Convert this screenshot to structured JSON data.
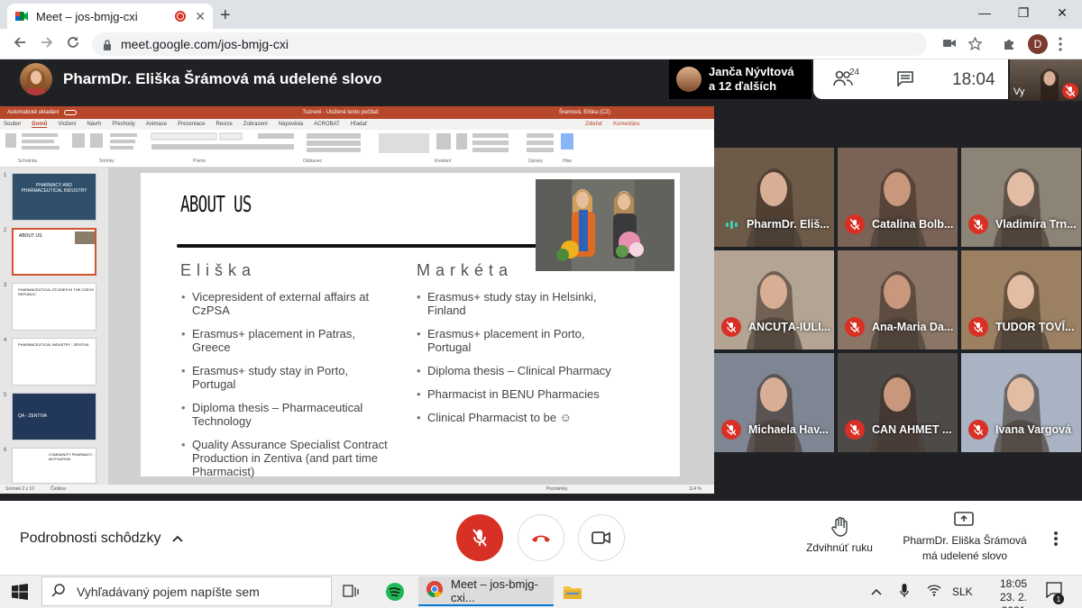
{
  "browser": {
    "tab_title": "Meet – jos-bmjg-cxi",
    "close_glyph": "✕",
    "new_tab_glyph": "+",
    "url": "meet.google.com/jos-bmjg-cxi",
    "profile_initial": "D",
    "win_controls": [
      "—",
      "❐",
      "✕"
    ]
  },
  "meet": {
    "presenter_title": "PharmDr. Eliška Šrámová má udelené slovo",
    "viewers_name": "Janča Nývltová",
    "viewers_more": "a 12 ďalších",
    "participant_count": "24",
    "time": "18:04",
    "self_label": "Vy"
  },
  "ppt": {
    "autosave": "Automatické ukladání",
    "doc_title": "Tuzneni - Uložené tento počítač",
    "search": "Hľadať",
    "user": "Šramová, Eliška (CZ)",
    "share": "Zdieľať",
    "comments": "Komentáre",
    "menu": [
      "Soubor",
      "Domů",
      "Vložení",
      "Návrh",
      "Přechody",
      "Animace",
      "Prezentace",
      "Revize",
      "Zobrazení",
      "Nápověda",
      "ACROBAT"
    ],
    "ribbon_groups": [
      "Schránka",
      "Snímky",
      "Písmo",
      "Odstavec",
      "Kreslení",
      "Úpravy",
      "Hlas"
    ],
    "thumb_numbers": [
      "1",
      "2",
      "3",
      "4",
      "5",
      "6"
    ],
    "thumb_titles": [
      "PHARMACY AND PHARMACEUTICAL INDUSTRY",
      "ABOUT US",
      "PHARMACEUTICAL STUDIES IN THE CZECH REPUBLIC",
      "PHARMACEUTICAL INDUSTRY - ZENTIVA",
      "QA - ZENTIVA",
      "COMMUNITY PHARMACY - MOTIVATION"
    ],
    "status_left": "Snímek 2 z 10",
    "status_lang": "Čeština",
    "status_notes": "Poznámky",
    "status_zoom": "114 %"
  },
  "slide": {
    "title": "ABOUT US",
    "left_name": "Eliška",
    "right_name": "Markéta",
    "left_items": [
      "Vicepresident of external affairs at CzPSA",
      "Erasmus+ placement in Patras, Greece",
      "Erasmus+ study stay in Porto, Portugal",
      "Diploma thesis – Pharmaceutical Technology",
      "Quality Assurance Specialist Contract Production in Zentiva (and part time Pharmacist)"
    ],
    "right_items": [
      "Erasmus+ study stay in Helsinki, Finland",
      "Erasmus+ placement in Porto, Portugal",
      "Diploma thesis – Clinical Pharmacy",
      "Pharmacist in BENU Pharmacies",
      "Clinical Pharmacist to be ☺"
    ]
  },
  "participants": [
    {
      "name": "PharmDr. Eliš...",
      "muted": false,
      "bg": "#6d5a48"
    },
    {
      "name": "Catalina Bolb...",
      "muted": true,
      "bg": "#7a6356"
    },
    {
      "name": "Vladimíra Trn...",
      "muted": true,
      "bg": "#8d8478"
    },
    {
      "name": "ANCUȚA-IULI...",
      "muted": true,
      "bg": "#b3a493"
    },
    {
      "name": "Ana-Maria Da...",
      "muted": true,
      "bg": "#8a7566"
    },
    {
      "name": "TUDOR ȚOVĪ...",
      "muted": true,
      "bg": "#9b8162"
    },
    {
      "name": "Michaela Hav...",
      "muted": true,
      "bg": "#7f8693"
    },
    {
      "name": "CAN AHMET ...",
      "muted": true,
      "bg": "#4e4a48"
    },
    {
      "name": "Ivana Vargová",
      "muted": true,
      "bg": "#a9b3c4"
    }
  ],
  "bottom": {
    "details": "Podrobnosti schôdzky",
    "raise_hand": "Zdvihnúť ruku",
    "present_line1": "PharmDr. Eliška Šrámová",
    "present_line2": "má udelené slovo"
  },
  "taskbar": {
    "search_placeholder": "Vyhľadávaný pojem napíšte sem",
    "chrome_item": "Meet – jos-bmjg-cxi...",
    "lang": "SLK",
    "time": "18:05",
    "date": "23. 2. 2021",
    "notif_count": "1"
  },
  "colors": {
    "meet_red": "#d93025",
    "ppt_orange": "#b7472a",
    "dark": "#202124"
  }
}
